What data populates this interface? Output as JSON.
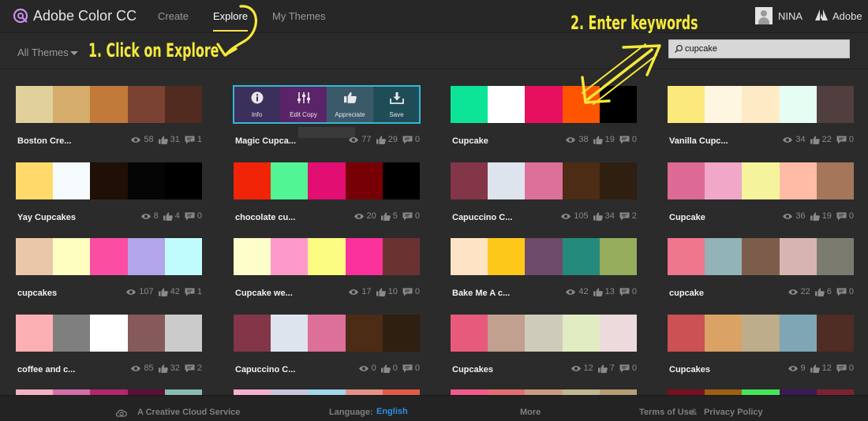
{
  "header": {
    "app_title": "Adobe Color CC",
    "nav": [
      {
        "label": "Create",
        "active": false
      },
      {
        "label": "Explore",
        "active": true
      },
      {
        "label": "My Themes",
        "active": false
      }
    ],
    "user_name": "NINA",
    "adobe_label": "Adobe",
    "accent": "#f4e04d"
  },
  "toolbar": {
    "filter_label": "All Themes",
    "search_value": "cupcake"
  },
  "annotations": {
    "step1": "1. Click on Explore",
    "step2": "2. Enter keywords",
    "color": "#f6e93a"
  },
  "hover_actions": [
    {
      "label": "Info",
      "icon": "info-icon",
      "color": "#3b2f5c"
    },
    {
      "label": "Edit Copy",
      "icon": "sliders-icon",
      "color": "#5b2468"
    },
    {
      "label": "Appreciate",
      "icon": "thumbs-up-icon",
      "color": "#3a5a6a"
    },
    {
      "label": "Save",
      "icon": "download-icon",
      "color": "#1f4d57"
    }
  ],
  "themes": [
    {
      "name": "Boston Cre...",
      "views": "58",
      "likes": "31",
      "comments": "1",
      "colors": [
        "#e0d09c",
        "#d5ac6b",
        "#c27a3a",
        "#7a4233",
        "#512a20"
      ]
    },
    {
      "name": "Magic Cupca...",
      "views": "77",
      "likes": "29",
      "comments": "0",
      "colors": [
        "#2e2046",
        "#4a2058",
        "#6a2a78",
        "#2b4c62",
        "#1b5a64"
      ],
      "hovered": true
    },
    {
      "name": "Cupcake",
      "views": "38",
      "likes": "19",
      "comments": "0",
      "colors": [
        "#0ce597",
        "#ffffff",
        "#e6105f",
        "#ff5400",
        "#000000"
      ]
    },
    {
      "name": "Vanilla Cupc...",
      "views": "34",
      "likes": "22",
      "comments": "0",
      "colors": [
        "#fbe97c",
        "#fff6e2",
        "#feebc5",
        "#e6fdf3",
        "#513f3f"
      ]
    },
    {
      "name": "Yay Cupcakes",
      "views": "8",
      "likes": "4",
      "comments": "0",
      "colors": [
        "#ffda6b",
        "#f5fbfd",
        "#1f0f05",
        "#050505",
        "#000000"
      ]
    },
    {
      "name": "chocolate cu...",
      "views": "20",
      "likes": "5",
      "comments": "0",
      "colors": [
        "#f12408",
        "#51f593",
        "#e20e72",
        "#760006",
        "#000000"
      ]
    },
    {
      "name": "Capuccino C...",
      "views": "105",
      "likes": "34",
      "comments": "2",
      "colors": [
        "#823648",
        "#dde4ee",
        "#dd7099",
        "#4c2c15",
        "#2e1f11"
      ]
    },
    {
      "name": "Cupcake",
      "views": "36",
      "likes": "19",
      "comments": "0",
      "colors": [
        "#dc6a94",
        "#f0a7c8",
        "#f5f49d",
        "#ffbba6",
        "#a5765a"
      ]
    },
    {
      "name": "cupcakes",
      "views": "107",
      "likes": "42",
      "comments": "1",
      "colors": [
        "#e9c7a8",
        "#fdfec0",
        "#fb4ea2",
        "#b2a5ea",
        "#c0fcfd"
      ]
    },
    {
      "name": "Cupcake we...",
      "views": "17",
      "likes": "10",
      "comments": "0",
      "colors": [
        "#fefeca",
        "#fd9ac9",
        "#fcfc83",
        "#fc329c",
        "#693332"
      ]
    },
    {
      "name": "Bake Me A c...",
      "views": "42",
      "likes": "13",
      "comments": "0",
      "colors": [
        "#fee4c4",
        "#fec81b",
        "#6e4a6b",
        "#248a7b",
        "#95ad5d"
      ]
    },
    {
      "name": "cupcake",
      "views": "22",
      "likes": "6",
      "comments": "0",
      "colors": [
        "#ee768d",
        "#92b3b8",
        "#7c5d4c",
        "#d6b5b1",
        "#7c7b70"
      ]
    },
    {
      "name": "coffee and c...",
      "views": "85",
      "likes": "32",
      "comments": "2",
      "colors": [
        "#fdb0b3",
        "#7f7f7f",
        "#ffffff",
        "#875a5a",
        "#cbcbcb"
      ]
    },
    {
      "name": "Capuccino C...",
      "views": "0",
      "likes": "0",
      "comments": "0",
      "colors": [
        "#823648",
        "#dde4ee",
        "#dd7099",
        "#4c2c15",
        "#2e1f11"
      ]
    },
    {
      "name": "Cupcakes",
      "views": "12",
      "likes": "7",
      "comments": "0",
      "colors": [
        "#e85a7c",
        "#c1a08f",
        "#cfcbbb",
        "#e2ecc3",
        "#eddadc"
      ]
    },
    {
      "name": "Cupcakes",
      "views": "9",
      "likes": "12",
      "comments": "0",
      "colors": [
        "#cc5155",
        "#daa264",
        "#bdad8a",
        "#7fa6b5",
        "#4f2c24"
      ]
    }
  ],
  "partial_row": [
    [
      "#f3b1c4",
      "#d26ea9",
      "#b5266f",
      "#5d0f3a",
      "#88bcb3"
    ],
    [
      "#f5b0d0",
      "#c8c4dd",
      "#a1d6eb",
      "#e59187",
      "#e25b47"
    ],
    [
      "#f5598a",
      "#e56e73",
      "#cc9b83",
      "#bfb893",
      "#b59c74"
    ],
    [
      "#7a0f21",
      "#9f6012",
      "#43e65a",
      "#3b1a5a",
      "#7d2233"
    ]
  ],
  "footer": {
    "service": "A Creative Cloud Service",
    "language_label": "Language:",
    "language_value": "English",
    "more": "More",
    "terms": "Terms of Use",
    "amp": "&",
    "privacy": "Privacy Policy"
  }
}
